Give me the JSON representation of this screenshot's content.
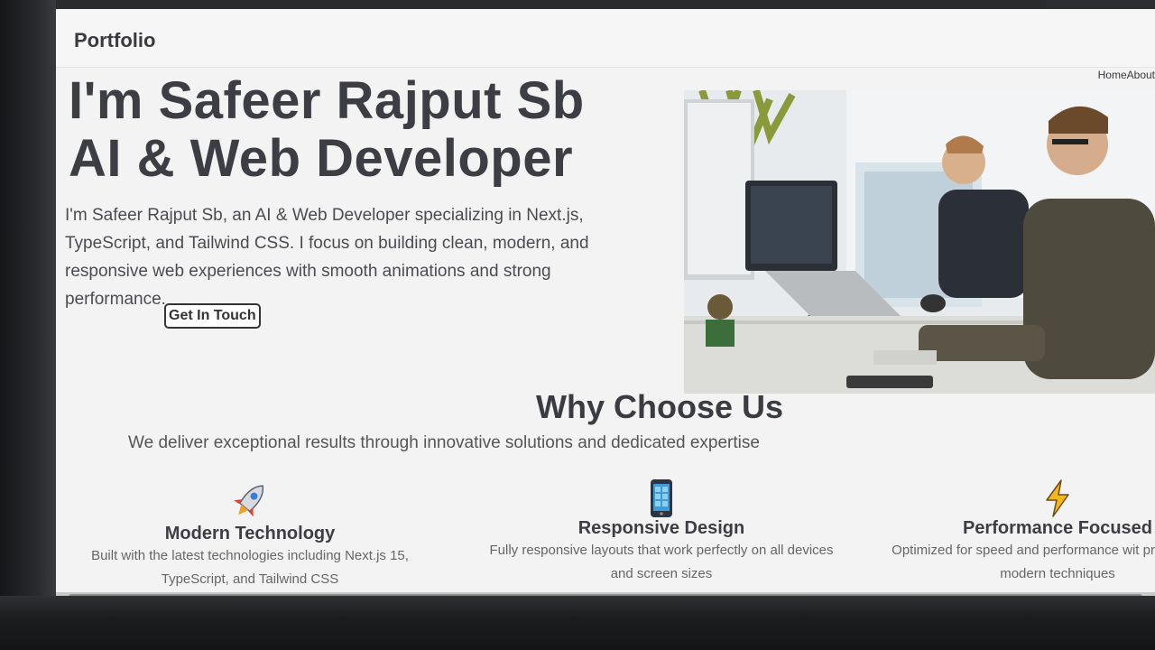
{
  "navbar": {
    "brand": "Portfolio",
    "links": "HomeAbout"
  },
  "hero": {
    "title_line1": "I'm Safeer Rajput Sb",
    "title_line2": "AI & Web Developer",
    "description": "I'm Safeer Rajput Sb, an AI & Web Developer specializing in Next.js, TypeScript, and Tailwind CSS. I focus on building clean, modern, and responsive web experiences with smooth animations and strong performance.",
    "cta_label": "Get In Touch"
  },
  "why": {
    "title": "Why Choose Us",
    "subtitle": "We deliver exceptional results through innovative solutions and dedicated expertise"
  },
  "features": [
    {
      "icon": "rocket-icon",
      "title": "Modern Technology",
      "text": "Built with the latest technologies including Next.js 15, TypeScript, and Tailwind CSS"
    },
    {
      "icon": "mobile-phone-icon",
      "title": "Responsive Design",
      "text": "Fully responsive layouts that work perfectly on all devices and screen sizes"
    },
    {
      "icon": "lightning-icon",
      "title": "Performance Focused",
      "text": "Optimized for speed and performance wit practices and modern techniques"
    }
  ],
  "colors": {
    "accent_orange": "#f0a020",
    "text_dark": "#3d3e44",
    "page_bg": "#f3f3f3"
  }
}
